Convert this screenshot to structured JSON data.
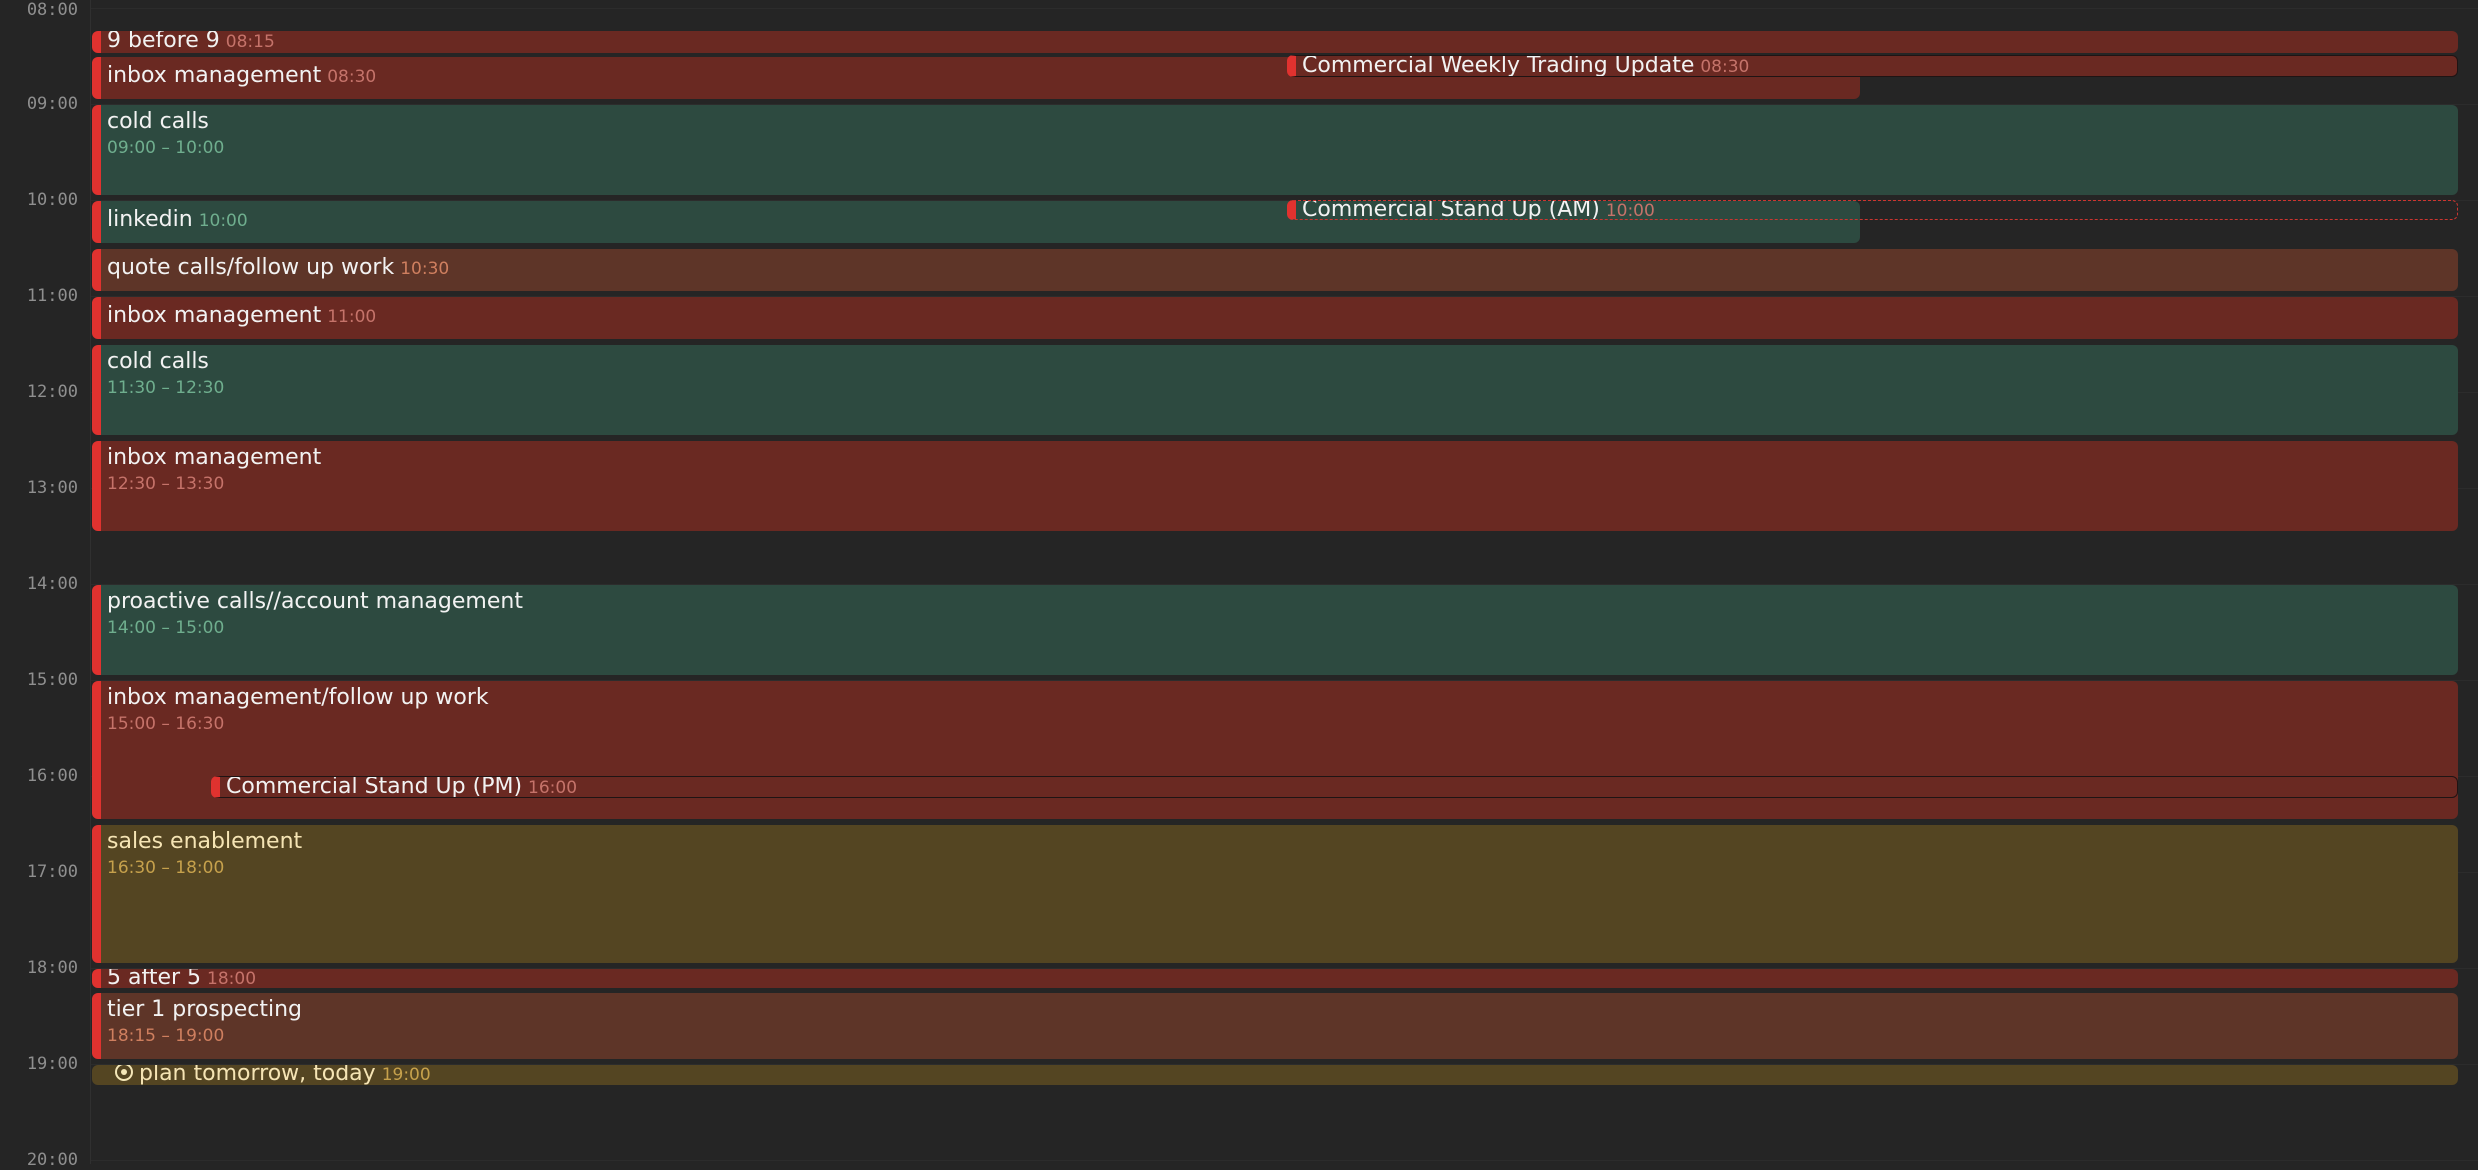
{
  "hours": [
    "08:00",
    "09:00",
    "10:00",
    "11:00",
    "12:00",
    "13:00",
    "14:00",
    "15:00",
    "16:00",
    "17:00",
    "18:00",
    "19:00",
    "20:00"
  ],
  "events": {
    "e1": {
      "title": "9 before 9",
      "time": "08:15"
    },
    "e2": {
      "title": "inbox management",
      "time": "08:30"
    },
    "e3": {
      "title": "Commercial Weekly Trading Update",
      "time": "08:30"
    },
    "e4": {
      "title": "cold calls",
      "time": "09:00 – 10:00"
    },
    "e5": {
      "title": "linkedin",
      "time": "10:00"
    },
    "e6": {
      "title": "Commercial Stand Up (AM)",
      "time": "10:00"
    },
    "e7": {
      "title": "quote calls/follow up work",
      "time": "10:30"
    },
    "e8": {
      "title": "inbox management",
      "time": "11:00"
    },
    "e9": {
      "title": "cold calls",
      "time": "11:30 – 12:30"
    },
    "e10": {
      "title": "inbox management",
      "time": "12:30 – 13:30"
    },
    "e11": {
      "title": "proactive calls//account management",
      "time": "14:00 – 15:00"
    },
    "e12": {
      "title": "inbox management/follow up work",
      "time": "15:00 – 16:30"
    },
    "e13": {
      "title": "Commercial Stand Up (PM)",
      "time": "16:00"
    },
    "e14": {
      "title": "sales enablement",
      "time": "16:30 – 18:00"
    },
    "e15": {
      "title": "5 after 5",
      "time": "18:00"
    },
    "e16": {
      "title": "tier 1 prospecting",
      "time": "18:15 – 19:00"
    },
    "e17": {
      "title": "plan tomorrow, today",
      "time": "19:00",
      "icon": "target-icon"
    }
  },
  "colors": {
    "accent": "#e0322f",
    "red_event": "#6a2922",
    "green_event": "#2d4a40",
    "brown_event": "#5e3528",
    "olive_event": "#544522",
    "background": "#252525"
  }
}
